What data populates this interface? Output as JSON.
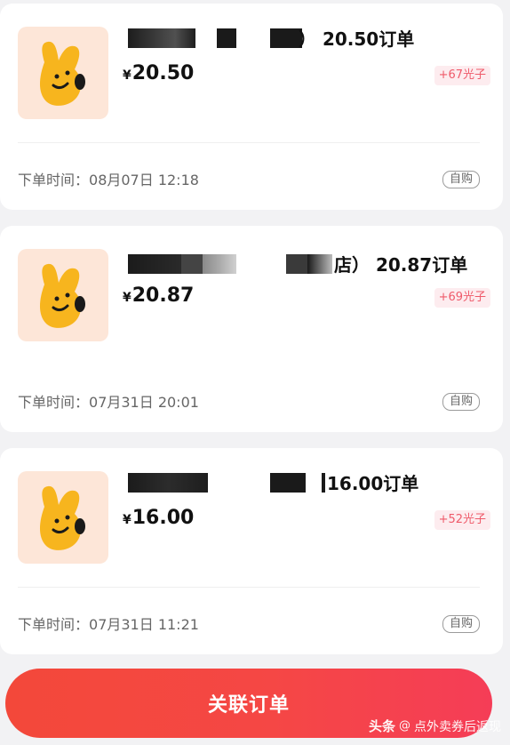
{
  "orders": [
    {
      "title_suffix": "） 20.50订单",
      "price_symbol": "¥",
      "price": "20.50",
      "points": "+67光子",
      "time_label": "下单时间：",
      "time_value": "08月07日 12:18",
      "tag": "自购"
    },
    {
      "title_suffix": "店） 20.87订单",
      "price_symbol": "¥",
      "price": "20.87",
      "points": "+69光子",
      "time_label": "下单时间：",
      "time_value": "07月31日 20:01",
      "tag": "自购"
    },
    {
      "title_suffix": "16.00订单",
      "price_symbol": "¥",
      "price": "16.00",
      "points": "+52光子",
      "time_label": "下单时间：",
      "time_value": "07月31日 11:21",
      "tag": "自购"
    }
  ],
  "footer": {
    "link_orders_label": "关联订单"
  },
  "watermark": {
    "brand": "头条",
    "at": "@",
    "account": "点外卖券后返现"
  },
  "colors": {
    "accent": "#f54745",
    "badge_text": "#ef5a6a",
    "badge_bg": "#fdecef",
    "thumb_bg": "#fde6d8",
    "mascot": "#f7b51e"
  },
  "icons": {
    "thumbnail": "mascot-bunny-icon"
  }
}
